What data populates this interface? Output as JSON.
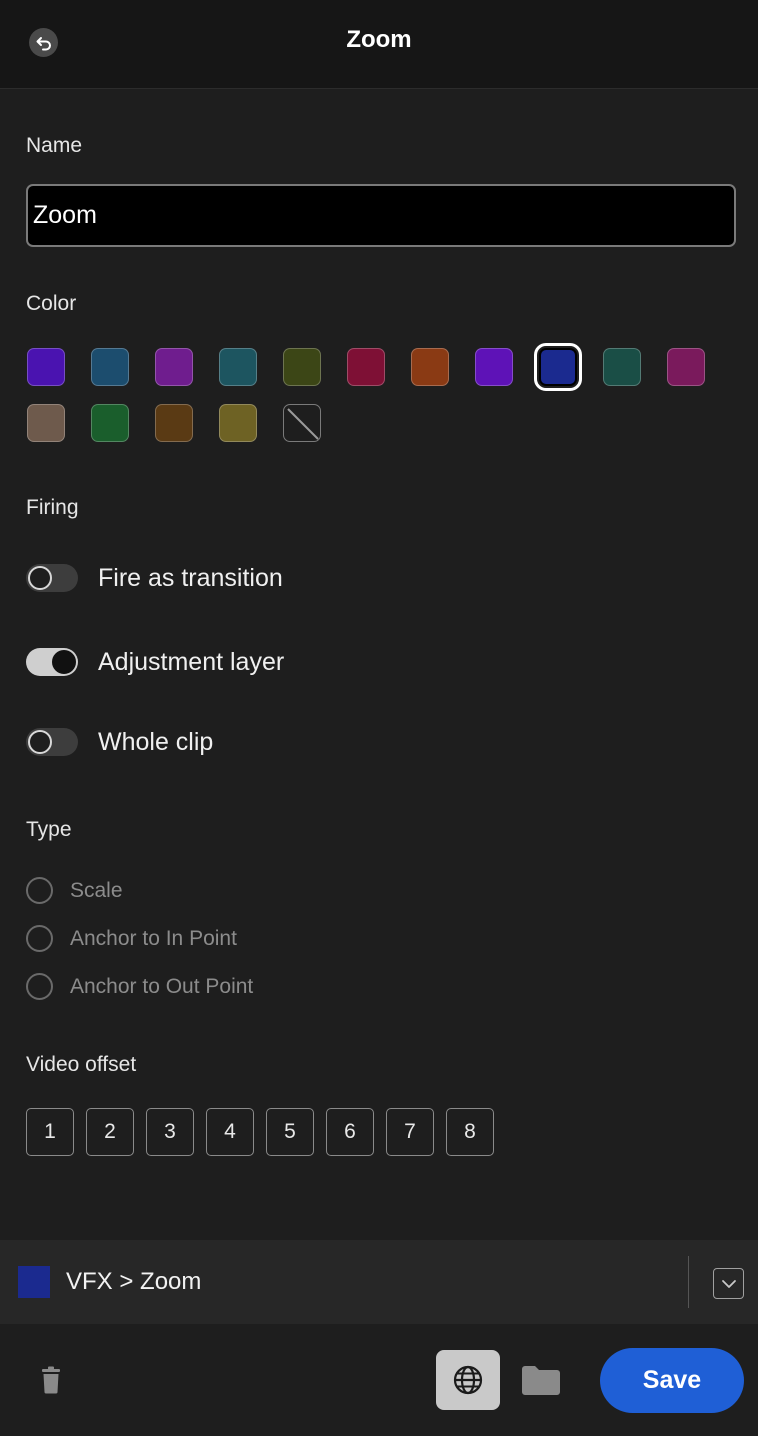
{
  "header": {
    "title": "Zoom"
  },
  "name": {
    "label": "Name",
    "value": "Zoom"
  },
  "color": {
    "label": "Color",
    "swatches": [
      "#4a13b0",
      "#1c4d6e",
      "#6f1d8e",
      "#1d5560",
      "#3c4616",
      "#7e1035",
      "#8a3a14",
      "#5e12b7",
      "#1b2a8f",
      "#1a4e46",
      "#7a1a5c",
      "#6e5a4c",
      "#1a5e2c",
      "#5a3a14",
      "#6e6224",
      "none"
    ],
    "selected_index": 8
  },
  "firing": {
    "label": "Firing",
    "toggles": [
      {
        "label": "Fire as transition",
        "on": false
      },
      {
        "label": "Adjustment layer",
        "on": true
      },
      {
        "label": "Whole clip",
        "on": false
      }
    ]
  },
  "type": {
    "label": "Type",
    "options": [
      "Scale",
      "Anchor to In Point",
      "Anchor to Out Point"
    ]
  },
  "video_offset": {
    "label": "Video offset",
    "buttons": [
      "1",
      "2",
      "3",
      "4",
      "5",
      "6",
      "7",
      "8"
    ]
  },
  "path": {
    "text": "VFX > Zoom",
    "color": "#1b2a8f"
  },
  "footer": {
    "save_label": "Save"
  },
  "icons": {
    "back": "undo-arrow-icon",
    "path_expand": "chevron-down-icon",
    "delete": "trash-icon",
    "web": "globe-icon",
    "folder": "folder-icon"
  }
}
